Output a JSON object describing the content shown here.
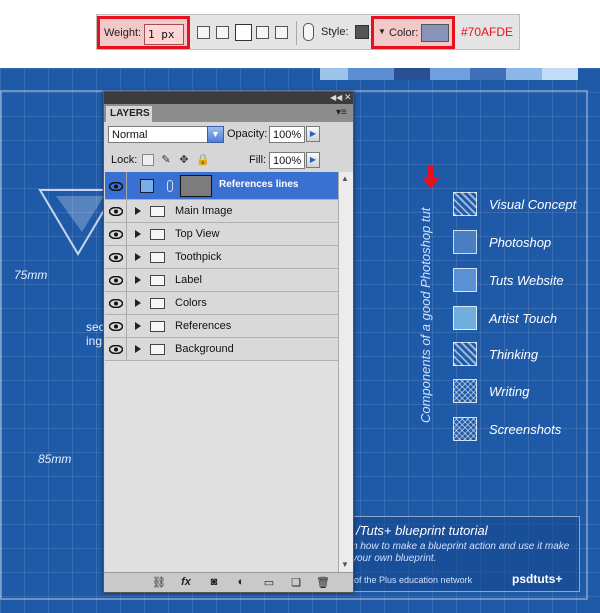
{
  "toolbar": {
    "weight_label": "Weight:",
    "weight_value": "1 px",
    "style_label": "Style:",
    "color_label": "Color:",
    "color_hex": "#70AFDE",
    "color_swatch": "#70AFDE"
  },
  "blueprint": {
    "dim_labels": [
      "75mm",
      "85mm"
    ],
    "partial_labels": [
      "sec",
      "ing"
    ],
    "vertical_text": "Components of a good Photoshop tut",
    "legend": [
      {
        "label": "Visual Concept",
        "icon": "hatch-pattern-icon"
      },
      {
        "label": "Photoshop",
        "icon": "solid-swatch-icon"
      },
      {
        "label": "Tuts Website",
        "icon": "solid-swatch-icon"
      },
      {
        "label": "Artist Touch",
        "icon": "solid-swatch-icon"
      },
      {
        "label": "Thinking",
        "icon": "hatch-pattern-icon"
      },
      {
        "label": "Writing",
        "icon": "cross-pattern-icon"
      },
      {
        "label": "Screenshots",
        "icon": "cross-pattern-icon"
      }
    ],
    "tut_title": "/Tuts+ blueprint tutorial",
    "tut_sub": "n how to make a blueprint action and use it make your own blueprint.",
    "tut_footer": "of the Plus education network",
    "brand": "psdtuts+"
  },
  "layers_panel": {
    "tab_label": "LAYERS",
    "blend_mode": "Normal",
    "opacity_label": "Opacity:",
    "opacity_value": "100%",
    "lock_label": "Lock:",
    "fill_label": "Fill:",
    "fill_value": "100%",
    "selected_layer": "References lines",
    "groups": [
      "Main Image",
      "Top View",
      "Toothpick",
      "Label",
      "Colors",
      "References",
      "Background"
    ]
  }
}
